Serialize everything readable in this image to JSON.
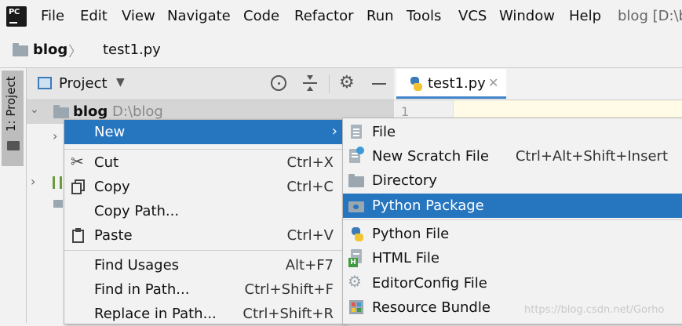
{
  "menubar": {
    "logo_text": "PC",
    "items": [
      {
        "label": "File"
      },
      {
        "label": "Edit"
      },
      {
        "label": "View"
      },
      {
        "label": "Navigate"
      },
      {
        "label": "Code"
      },
      {
        "label": "Refactor"
      },
      {
        "label": "Run"
      },
      {
        "label": "Tools"
      },
      {
        "label": "VCS"
      },
      {
        "label": "Window"
      },
      {
        "label": "Help"
      }
    ],
    "window_title": "blog [D:\\b"
  },
  "breadcrumb": {
    "root": "blog",
    "file": "test1.py"
  },
  "toolstrip": {
    "project_label": "1: Project"
  },
  "project_panel": {
    "title": "Project",
    "tree": {
      "root_name": "blog",
      "root_path": "D:\\blog"
    }
  },
  "editor": {
    "tab_label": "test1.py",
    "line_number": "1"
  },
  "context_menu": {
    "items": [
      {
        "label": "New",
        "shortcut": "",
        "selected": true
      },
      {
        "label": "Cut",
        "shortcut": "Ctrl+X"
      },
      {
        "label": "Copy",
        "shortcut": "Ctrl+C"
      },
      {
        "label": "Copy Path...",
        "shortcut": ""
      },
      {
        "label": "Paste",
        "shortcut": "Ctrl+V"
      },
      {
        "label": "Find Usages",
        "shortcut": "Alt+F7"
      },
      {
        "label": "Find in Path...",
        "shortcut": "Ctrl+Shift+F"
      },
      {
        "label": "Replace in Path...",
        "shortcut": "Ctrl+Shift+R"
      }
    ]
  },
  "submenu": {
    "items": [
      {
        "label": "File",
        "shortcut": ""
      },
      {
        "label": "New Scratch File",
        "shortcut": "Ctrl+Alt+Shift+Insert"
      },
      {
        "label": "Directory",
        "shortcut": ""
      },
      {
        "label": "Python Package",
        "shortcut": "",
        "selected": true
      },
      {
        "label": "Python File",
        "shortcut": ""
      },
      {
        "label": "HTML File",
        "shortcut": ""
      },
      {
        "label": "EditorConfig File",
        "shortcut": ""
      },
      {
        "label": "Resource Bundle",
        "shortcut": ""
      }
    ]
  },
  "watermark": "https://blog.csdn.net/Gorho",
  "colors": {
    "selection": "#2675bf",
    "panel_bg": "#f2f2f2",
    "folder": "#9aa7b0",
    "tab_underline": "#4083c9"
  }
}
